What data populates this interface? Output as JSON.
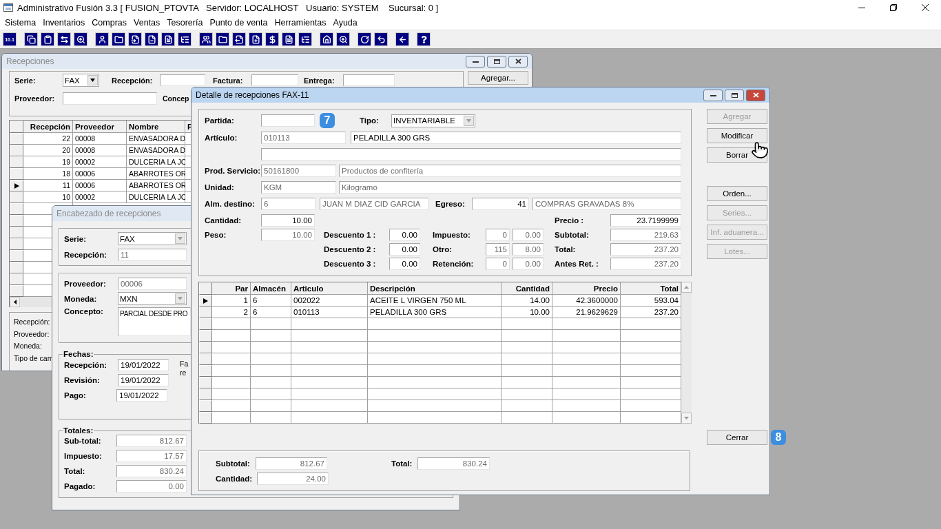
{
  "app": {
    "title": "Administrativo Fusión 3.3 [ FUSION_PTOVTA   Servidor: LOCALHOST   Usuario: SYSTEM    Sucursal: 0 ]"
  },
  "menu": [
    "Sistema",
    "Inventarios",
    "Compras",
    "Ventas",
    "Tesorería",
    "Punto de venta",
    "Herramientas",
    "Ayuda"
  ],
  "toolbar": {
    "first_button_label": "10.1"
  },
  "receptions_window": {
    "title": "Recepciones",
    "active": false,
    "serie": {
      "label": "Serie:",
      "value": "FAX",
      "disabled": false
    },
    "recepcion_label": "Recepción:",
    "factura_label": "Factura:",
    "entrega_label": "Entrega:",
    "proveedor_label": "Proveedor:",
    "concepto_label": "Concep",
    "add_button": "Agregar...",
    "columns": [
      "Recepción",
      "Proveedor",
      "Nombre",
      "F"
    ],
    "rows": [
      {
        "cells": [
          "22",
          "00008",
          "ENVASADORA D"
        ],
        "selected": false
      },
      {
        "cells": [
          "20",
          "00008",
          "ENVASADORA D"
        ],
        "selected": false
      },
      {
        "cells": [
          "19",
          "00002",
          "DULCERIA LA JC"
        ],
        "selected": false
      },
      {
        "cells": [
          "18",
          "00006",
          "ABARROTES OR"
        ],
        "selected": false
      },
      {
        "cells": [
          "11",
          "00006",
          "ABARROTES OR"
        ],
        "selected": true
      },
      {
        "cells": [
          "10",
          "00002",
          "DULCERIA LA JC"
        ],
        "selected": false
      }
    ],
    "summary_labels": [
      "Recepción:",
      "Proveedor:",
      "Moneda:",
      "Tipo de cam"
    ]
  },
  "header_window": {
    "title": "Encabezado de recepciones",
    "active": false,
    "serie": {
      "label": "Serie:",
      "value": "FAX",
      "disabled": true
    },
    "recepcion": {
      "label": "Recepción:",
      "value": "11",
      "readonly": true
    },
    "proveedor": {
      "label": "Proveedor:",
      "value": "00006",
      "readonly": true
    },
    "moneda": {
      "label": "Moneda:",
      "value": "MXN",
      "disabled": true
    },
    "concepto": {
      "label": "Concepto:",
      "value": "PARCIAL DESDE PRO"
    },
    "fechas": {
      "title": "Fechas:",
      "rows": [
        {
          "label": "Recepción:",
          "value": "19/01/2022",
          "readonly": false
        },
        {
          "label": "Revisión:",
          "value": "19/01/2022",
          "readonly": false
        },
        {
          "label": "Pago:",
          "value": "19/01/2022",
          "readonly": false
        }
      ],
      "note_lines": [
        "Fa",
        "re"
      ]
    },
    "totales": {
      "title": "Totales:",
      "rows": [
        {
          "label": "Sub-total:",
          "value": "812.67",
          "readonly": true
        },
        {
          "label": "Impuesto:",
          "value": "17.57",
          "readonly": true
        },
        {
          "label": "Total:",
          "value": "830.24",
          "readonly": true
        },
        {
          "label": "Pagado:",
          "value": "0.00",
          "readonly": true
        }
      ]
    }
  },
  "detail_window": {
    "title": "Detalle de recepciones FAX-11",
    "active": true,
    "form": {
      "partida": {
        "label": "Partida:"
      },
      "tipo": {
        "label": "Tipo:",
        "value": "INVENTARIABLE",
        "disabled": true
      },
      "articulo": {
        "label": "Artículo:",
        "code": {
          "value": "010113",
          "readonly": true
        },
        "name": {
          "value": "PELADILLA 300 GRS",
          "readonly": false
        }
      },
      "prod_servicio": {
        "label": "Prod. Servicio:",
        "code": {
          "value": "50161800",
          "readonly": true
        },
        "name": {
          "value": "Productos de confitería",
          "readonly": true
        }
      },
      "unidad": {
        "label": "Unidad:",
        "code": {
          "value": "KGM",
          "readonly": true
        },
        "name": {
          "value": "Kilogramo",
          "readonly": true
        }
      },
      "alm_destino": {
        "label": "Alm. destino:",
        "code": {
          "value": "6",
          "readonly": true
        },
        "name": {
          "value": "JUAN M DIAZ CID GARCIA",
          "readonly": true
        }
      },
      "egreso": {
        "label": "Egreso:",
        "code": {
          "value": "41",
          "readonly": false
        },
        "name": {
          "value": "COMPRAS GRAVADAS 8%",
          "readonly": true
        }
      },
      "cantidad": {
        "label": "Cantidad:",
        "value": {
          "value": "10.00",
          "readonly": false
        }
      },
      "peso": {
        "label": "Peso:",
        "value": {
          "value": "10.00",
          "readonly": true
        }
      },
      "descuentos": [
        {
          "label": "Descuento 1 :",
          "value": {
            "value": "0.00",
            "readonly": false
          }
        },
        {
          "label": "Descuento 2 :",
          "value": {
            "value": "0.00",
            "readonly": false
          }
        },
        {
          "label": "Descuento 3 :",
          "value": {
            "value": "0.00",
            "readonly": false
          }
        }
      ],
      "impuestos": [
        {
          "label": "Impuesto:",
          "rate": {
            "value": "0",
            "readonly": true
          },
          "amount": {
            "value": "0.00",
            "readonly": true
          }
        },
        {
          "label": "Otro:",
          "rate": {
            "value": "115",
            "readonly": true
          },
          "amount": {
            "value": "8.00",
            "readonly": true
          }
        },
        {
          "label": "Retención:",
          "rate": {
            "value": "0",
            "readonly": true
          },
          "amount": {
            "value": "0.00",
            "readonly": true
          }
        }
      ],
      "totals": [
        {
          "label": "Precio :",
          "value": {
            "value": "23.7199999",
            "readonly": false
          }
        },
        {
          "label": "Subtotal:",
          "value": {
            "value": "219.63",
            "readonly": true
          }
        },
        {
          "label": "Total:",
          "value": {
            "value": "237.20",
            "readonly": true
          }
        },
        {
          "label": "Antes Ret. :",
          "value": {
            "value": "237.20",
            "readonly": true
          }
        }
      ]
    },
    "edit_buttons": [
      {
        "label": "Agregar",
        "disabled": true
      },
      {
        "label": "Modificar",
        "disabled": false
      },
      {
        "label": "Borrar",
        "disabled": false
      }
    ],
    "other_buttons": [
      {
        "label": "Orden...",
        "disabled": false
      },
      {
        "label": "Series...",
        "disabled": true
      },
      {
        "label": "Inf. aduanera...",
        "disabled": true
      },
      {
        "label": "Lotes...",
        "disabled": true
      }
    ],
    "grid": {
      "columns": [
        "Par",
        "Almacén",
        "Articulo",
        "Descripción",
        "Cantidad",
        "Precio",
        "Total"
      ],
      "rows": [
        {
          "cells": [
            "1",
            "6",
            "002022",
            "ACEITE L VIRGEN 750 ML",
            "14.00",
            "42.3600000",
            "593.04"
          ],
          "selected": true
        },
        {
          "cells": [
            "2",
            "6",
            "010113",
            "PELADILLA 300 GRS",
            "10.00",
            "21.9629629",
            "237.20"
          ],
          "selected": false
        }
      ]
    },
    "close_button": "Cerrar",
    "summary": {
      "subtotal": {
        "label": "Subtotal:",
        "value": "812.67"
      },
      "total": {
        "label": "Total:",
        "value": "830.24"
      },
      "cantidad": {
        "label": "Cantidad:",
        "value": "24.00"
      }
    }
  },
  "callouts": [
    {
      "label": "7"
    },
    {
      "label": "8"
    }
  ]
}
